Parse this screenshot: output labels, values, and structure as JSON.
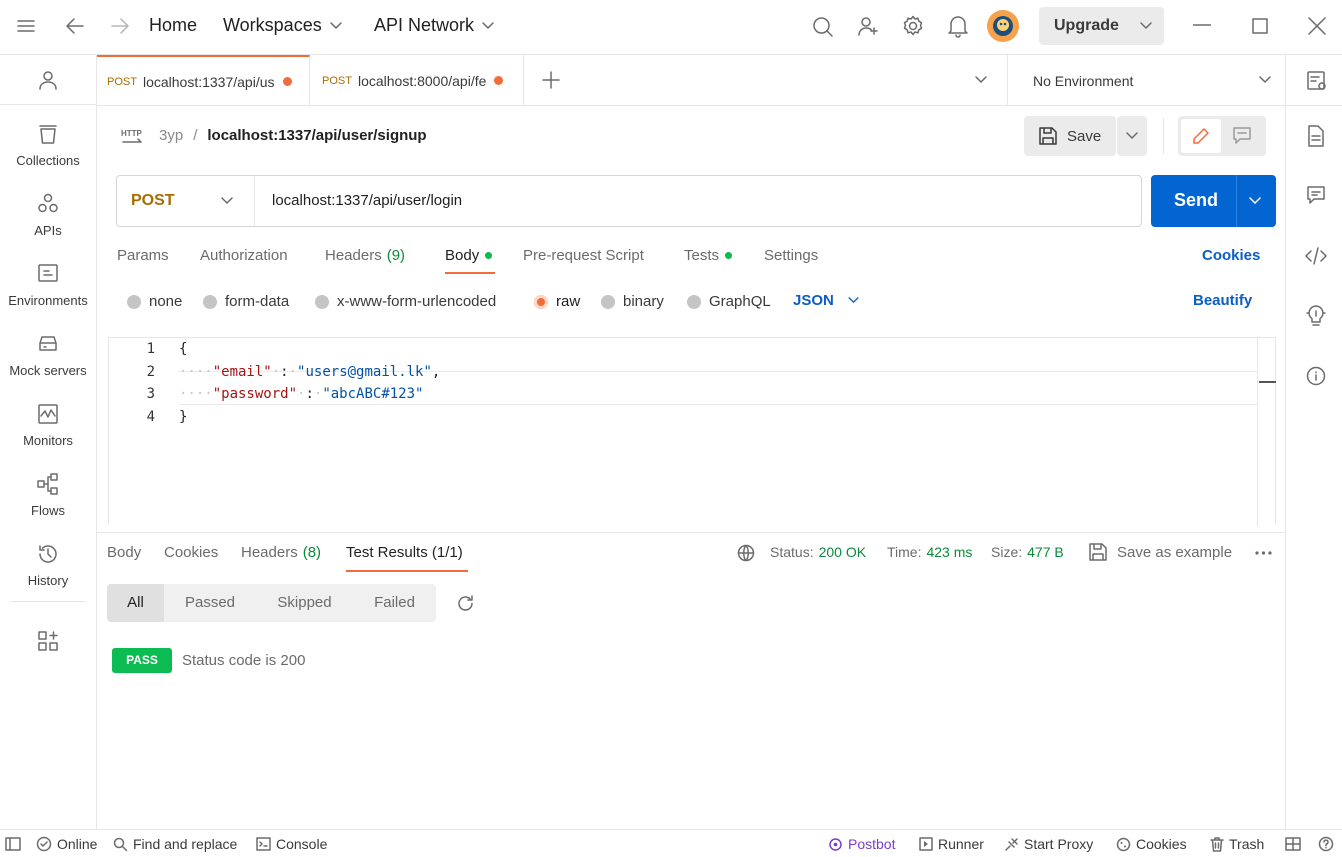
{
  "topbar": {
    "home": "Home",
    "workspaces": "Workspaces",
    "api_network": "API Network",
    "upgrade": "Upgrade"
  },
  "sidebar": {
    "items": [
      {
        "label": "Collections",
        "icon": "collections-icon"
      },
      {
        "label": "APIs",
        "icon": "apis-icon"
      },
      {
        "label": "Environments",
        "icon": "environments-icon"
      },
      {
        "label": "Mock servers",
        "icon": "mock-servers-icon"
      },
      {
        "label": "Monitors",
        "icon": "monitors-icon"
      },
      {
        "label": "Flows",
        "icon": "flows-icon"
      },
      {
        "label": "History",
        "icon": "history-icon"
      }
    ]
  },
  "tabs": [
    {
      "method": "POST",
      "url": "localhost:1337/api/us"
    },
    {
      "method": "POST",
      "url": "localhost:8000/api/fe"
    }
  ],
  "environment": "No Environment",
  "breadcrumb": {
    "workspace": "3yp",
    "separator": "/",
    "request": "localhost:1337/api/user/signup"
  },
  "save_label": "Save",
  "request": {
    "method": "POST",
    "url": "localhost:1337/api/user/login",
    "send": "Send"
  },
  "request_tabs": {
    "params": "Params",
    "authorization": "Authorization",
    "headers": "Headers",
    "headers_count": "(9)",
    "body": "Body",
    "pre_request": "Pre-request Script",
    "tests": "Tests",
    "settings": "Settings",
    "cookies": "Cookies"
  },
  "body_types": {
    "none": "none",
    "form_data": "form-data",
    "urlencoded": "x-www-form-urlencoded",
    "raw": "raw",
    "binary": "binary",
    "graphql": "GraphQL",
    "format": "JSON",
    "beautify": "Beautify",
    "selected": "raw"
  },
  "editor": {
    "line_numbers": [
      "1",
      "2",
      "3",
      "4"
    ],
    "open_brace": "{",
    "close_brace": "}",
    "email_key": "\"email\"",
    "email_value": "\"users@gmail.lk\"",
    "password_key": "\"password\"",
    "password_value": "\"abcABC#123\""
  },
  "response": {
    "tabs": {
      "body": "Body",
      "cookies": "Cookies",
      "headers": "Headers",
      "headers_count": "(8)",
      "test_results": "Test Results (1/1)"
    },
    "status_label": "Status:",
    "status_value": "200 OK",
    "time_label": "Time:",
    "time_value": "423 ms",
    "size_label": "Size:",
    "size_value": "477 B",
    "save_example": "Save as example",
    "filters": [
      "All",
      "Passed",
      "Skipped",
      "Failed"
    ],
    "selected_filter": "All",
    "result_badge": "PASS",
    "result_text": "Status code is 200"
  },
  "statusbar": {
    "online": "Online",
    "find_replace": "Find and replace",
    "console": "Console",
    "postbot": "Postbot",
    "runner": "Runner",
    "start_proxy": "Start Proxy",
    "cookies": "Cookies",
    "trash": "Trash"
  },
  "colors": {
    "accent": "#f26b3a",
    "send_button": "#0265d2",
    "link_blue": "#0c5ec4",
    "success_green": "#0cbb52",
    "method_post": "#a86c00"
  }
}
